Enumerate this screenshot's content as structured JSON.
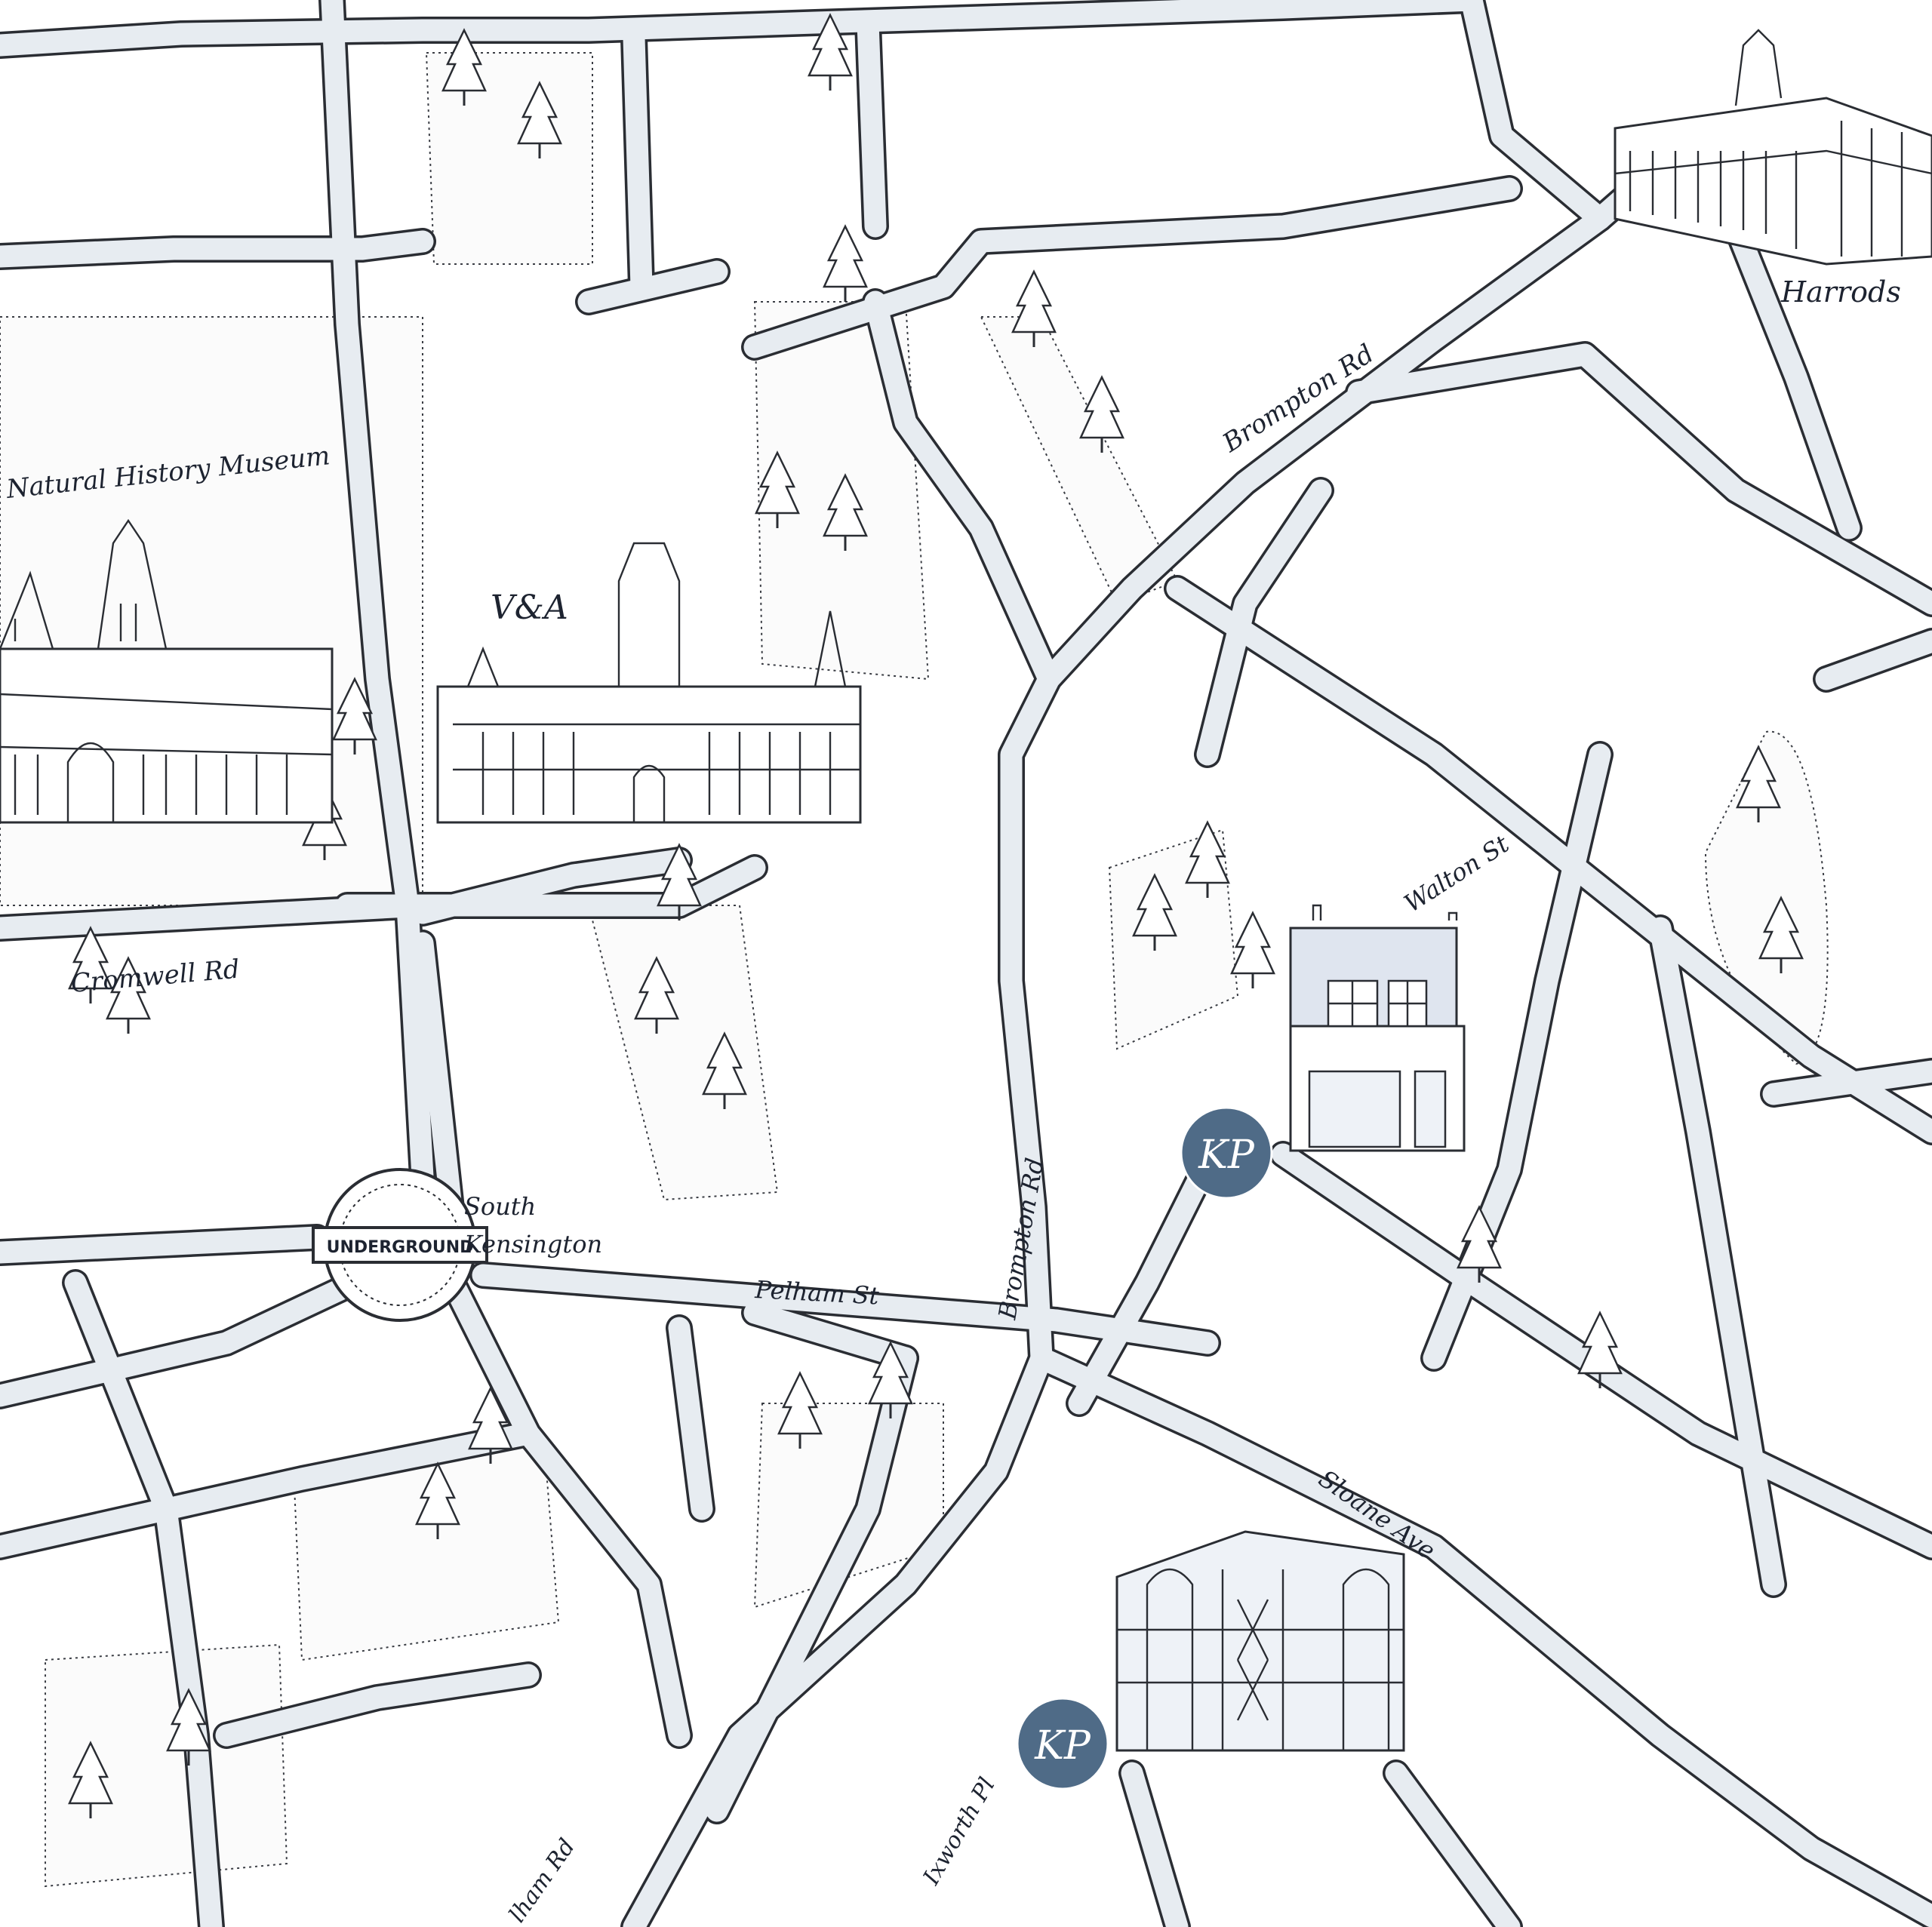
{
  "map": {
    "street_labels": {
      "brompton_rd_north": "Brompton Rd",
      "brompton_rd_south": "Brompton Rd",
      "cromwell_rd": "Cromwell Rd",
      "pelham_st": "Pelham St",
      "walton_st": "Walton St",
      "sloane_ave": "Sloane Ave",
      "ixworth_pl": "Ixworth Pl",
      "fulham_rd_partial": "lham Rd"
    },
    "landmarks": {
      "natural_history_museum": "Natural History Museum",
      "va": "V&A",
      "harrods": "Harrods"
    },
    "station": {
      "roundel_text": "UNDERGROUND",
      "name_line1": "South",
      "name_line2": "Kensington"
    },
    "markers": [
      {
        "text": "KP"
      },
      {
        "text": "KP"
      }
    ],
    "colors": {
      "road_fill": "#e7ecf1",
      "road_outline": "#2a2d33",
      "marker": "#4f6b87",
      "highlight_building": "#dfe5ef",
      "roundel_red": "#ffffff"
    }
  }
}
